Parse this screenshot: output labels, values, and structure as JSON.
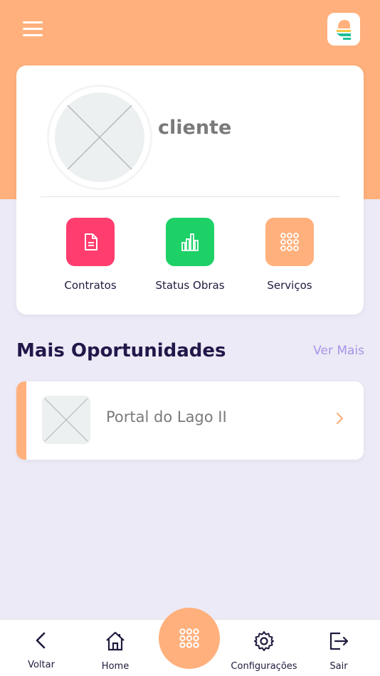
{
  "colors": {
    "header_bg": "#FFB07C",
    "page_bg": "#ECEAF6",
    "contracts_tile": "#FF3D6E",
    "status_tile": "#1DD167",
    "services_tile": "#FFB07C",
    "accent_purple": "#A893E8",
    "heading_dark": "#23174A"
  },
  "header": {
    "menu_icon": "hamburger-icon",
    "logo_icon": "app-logo"
  },
  "profile": {
    "name": "cliente",
    "avatar_icon": "image-placeholder-icon"
  },
  "actions": [
    {
      "label": "Contratos",
      "icon": "document-icon"
    },
    {
      "label": "Status Obras",
      "icon": "bar-chart-icon"
    },
    {
      "label": "Serviços",
      "icon": "grid-dots-icon"
    }
  ],
  "opportunities": {
    "title": "Mais Oportunidades",
    "see_more": "Ver Mais",
    "items": [
      {
        "title": "Portal do Lago II",
        "icon": "image-placeholder-icon"
      }
    ]
  },
  "bottom_nav": {
    "items": [
      {
        "label": "Voltar",
        "icon": "chevron-left-icon"
      },
      {
        "label": "Home",
        "icon": "home-icon"
      },
      {
        "label": "Configurações",
        "icon": "gear-icon"
      },
      {
        "label": "Sair",
        "icon": "logout-icon"
      }
    ],
    "center_icon": "grid-dots-icon"
  }
}
